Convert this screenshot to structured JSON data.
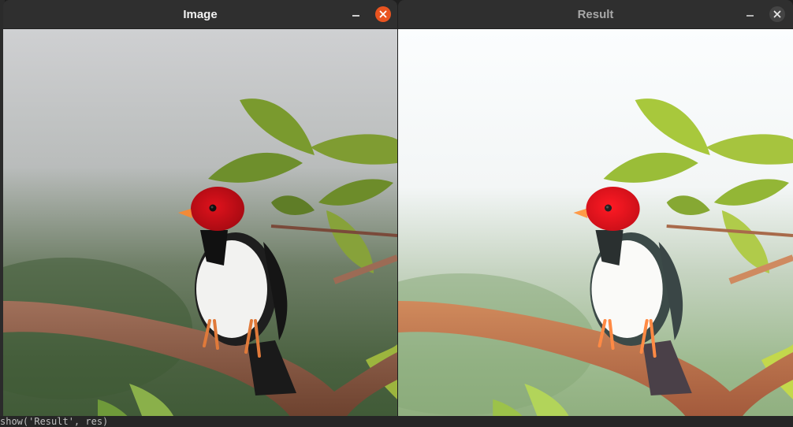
{
  "windows": {
    "image": {
      "title": "Image",
      "active": true
    },
    "result": {
      "title": "Result",
      "active": false
    }
  },
  "editor": {
    "snippet": "show('Result', res)"
  },
  "colors": {
    "accent_close": "#e95420",
    "titlebar": "#2f2f2f"
  }
}
